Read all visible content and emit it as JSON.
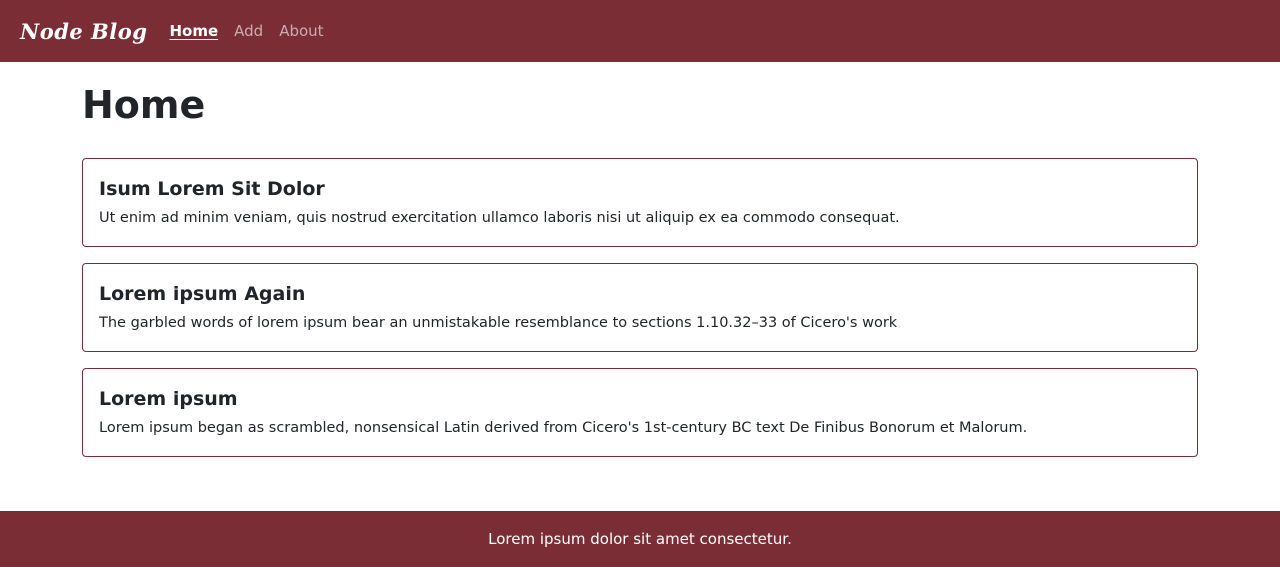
{
  "navbar": {
    "brand": "Node Blog",
    "links": [
      {
        "label": "Home",
        "active": true
      },
      {
        "label": "Add",
        "active": false
      },
      {
        "label": "About",
        "active": false
      }
    ]
  },
  "main": {
    "title": "Home",
    "posts": [
      {
        "title": "Isum Lorem Sit Dolor",
        "snippet": "Ut enim ad minim veniam, quis nostrud exercitation ullamco laboris nisi ut aliquip ex ea commodo consequat."
      },
      {
        "title": "Lorem ipsum Again",
        "snippet": "The garbled words of lorem ipsum bear an unmistakable resemblance to sections 1.10.32–33 of Cicero's work"
      },
      {
        "title": "Lorem ipsum",
        "snippet": "Lorem ipsum began as scrambled, nonsensical Latin derived from Cicero's 1st-century BC text De Finibus Bonorum et Malorum."
      }
    ]
  },
  "footer": {
    "text": "Lorem ipsum dolor sit amet consectetur."
  },
  "colors": {
    "brand": "#7b2d35",
    "text": "#212529",
    "background": "#ffffff"
  }
}
